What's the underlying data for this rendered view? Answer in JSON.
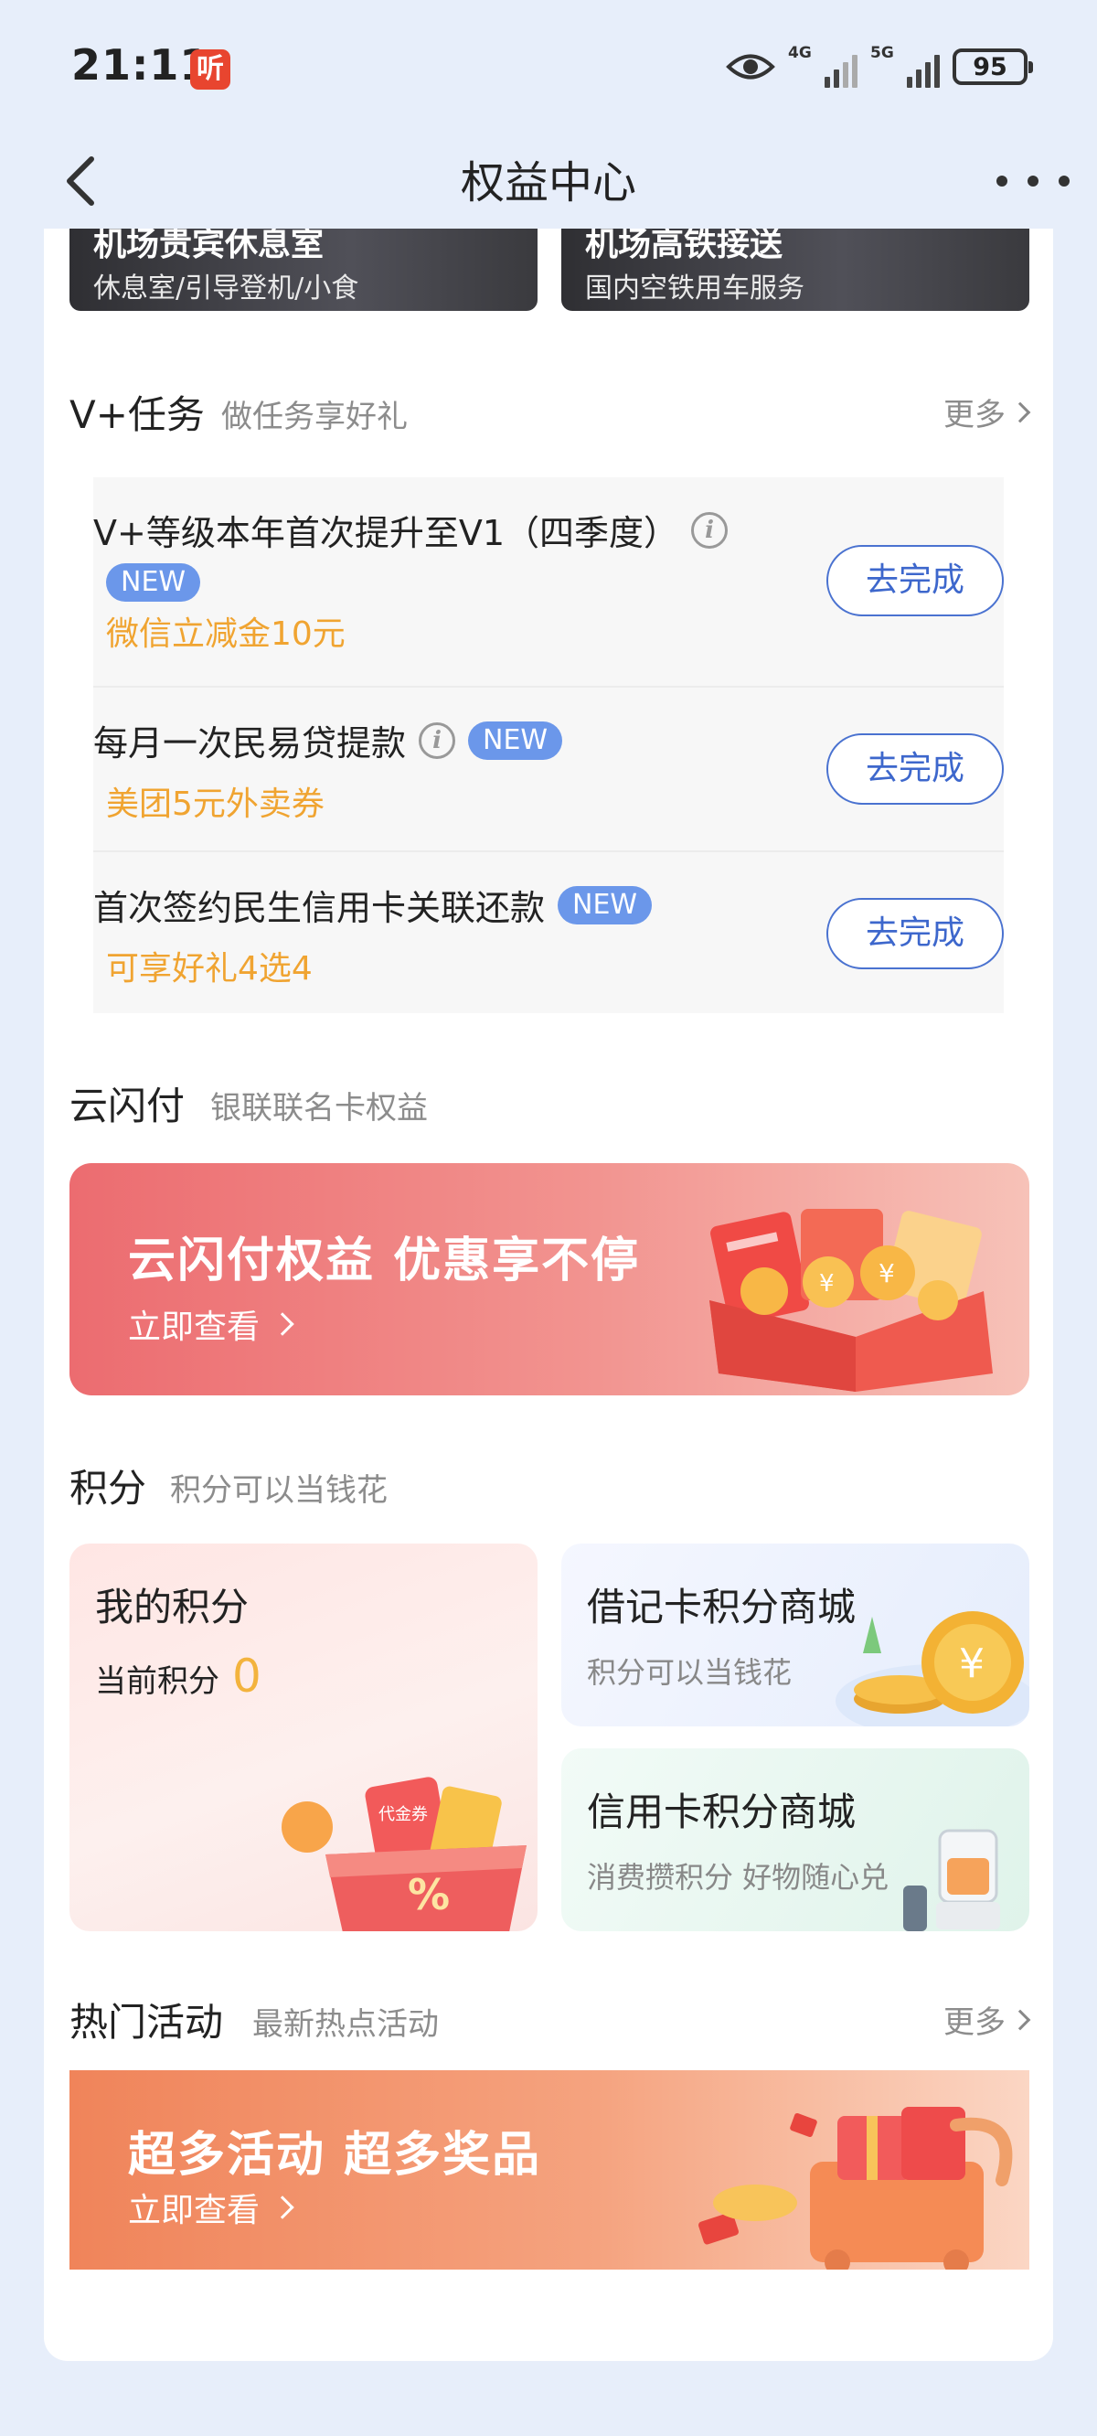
{
  "status_bar": {
    "time": "21:11",
    "app_badge": "听",
    "net1": "4G",
    "net2": "5G",
    "battery": "95"
  },
  "nav": {
    "title": "权益中心"
  },
  "top_banners": [
    {
      "title": "机场贵宾休息室",
      "sub": "休息室/引导登机/小食"
    },
    {
      "title": "机场高铁接送",
      "sub": "国内空铁用车服务"
    }
  ],
  "tasks_section": {
    "title": "V+任务",
    "subtitle": "做任务享好礼",
    "more": "更多",
    "items": [
      {
        "title": "V+等级本年首次提升至V1（四季度）",
        "badge": "NEW",
        "reward": "微信立减金10元",
        "button": "去完成"
      },
      {
        "title": "每月一次民易贷提款",
        "badge": "NEW",
        "reward": "美团5元外卖券",
        "button": "去完成"
      },
      {
        "title": "首次签约民生信用卡关联还款",
        "badge": "NEW",
        "reward": "可享好礼4选4",
        "button": "去完成"
      }
    ]
  },
  "unionpay_section": {
    "title": "云闪付",
    "subtitle": "银联联名卡权益",
    "banner_title": "云闪付权益 优惠享不停",
    "banner_link": "立即查看"
  },
  "points_section": {
    "title": "积分",
    "subtitle": "积分可以当钱花",
    "my_points": {
      "title": "我的积分",
      "label": "当前积分",
      "value": "0",
      "coupon_text": "代金券"
    },
    "debit_mall": {
      "title": "借记卡积分商城",
      "sub": "积分可以当钱花"
    },
    "credit_mall": {
      "title": "信用卡积分商城",
      "sub": "消费攒积分 好物随心兑"
    }
  },
  "activity_section": {
    "title": "热门活动",
    "subtitle": "最新热点活动",
    "more": "更多",
    "banner_title": "超多活动 超多奖品",
    "banner_link": "立即查看"
  }
}
